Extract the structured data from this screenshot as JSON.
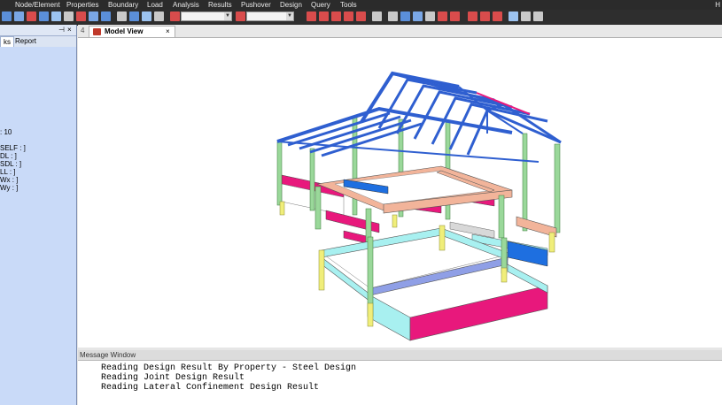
{
  "menu": {
    "items": [
      "Node/Element",
      "Properties",
      "Boundary",
      "Load",
      "Analysis",
      "Results",
      "Pushover",
      "Design",
      "Query",
      "Tools"
    ],
    "right_label": "H"
  },
  "toolbar": {
    "combo1_value": "",
    "combo2_value": ""
  },
  "left_panel": {
    "tabs": [
      "ks",
      "Report"
    ],
    "lines": [
      ": 10",
      "SELF : ]",
      "DL : ]",
      "SDL : ]",
      "LL : ]",
      "Wx : ]",
      "Wy : ]"
    ]
  },
  "viewport": {
    "tab_number": "4",
    "tab_label": "Model View",
    "close_glyph": "×"
  },
  "message_window": {
    "title": "Message Window",
    "lines": [
      "Reading Design Result By Property - Steel Design",
      "Reading Joint Design Result",
      "Reading Lateral Confinement Design Result"
    ]
  },
  "colors": {
    "truss": "#2f5fd0",
    "column_green": "#9ad89a",
    "beam_magenta": "#e8187c",
    "beam_salmon": "#f2b49a",
    "beam_cyan": "#a8f0f0",
    "beam_blue": "#1e6fe0",
    "footing_yellow": "#f0ee7a",
    "beam_grey": "#d8d8d8",
    "beam_periwinkle": "#8f9fe6"
  }
}
